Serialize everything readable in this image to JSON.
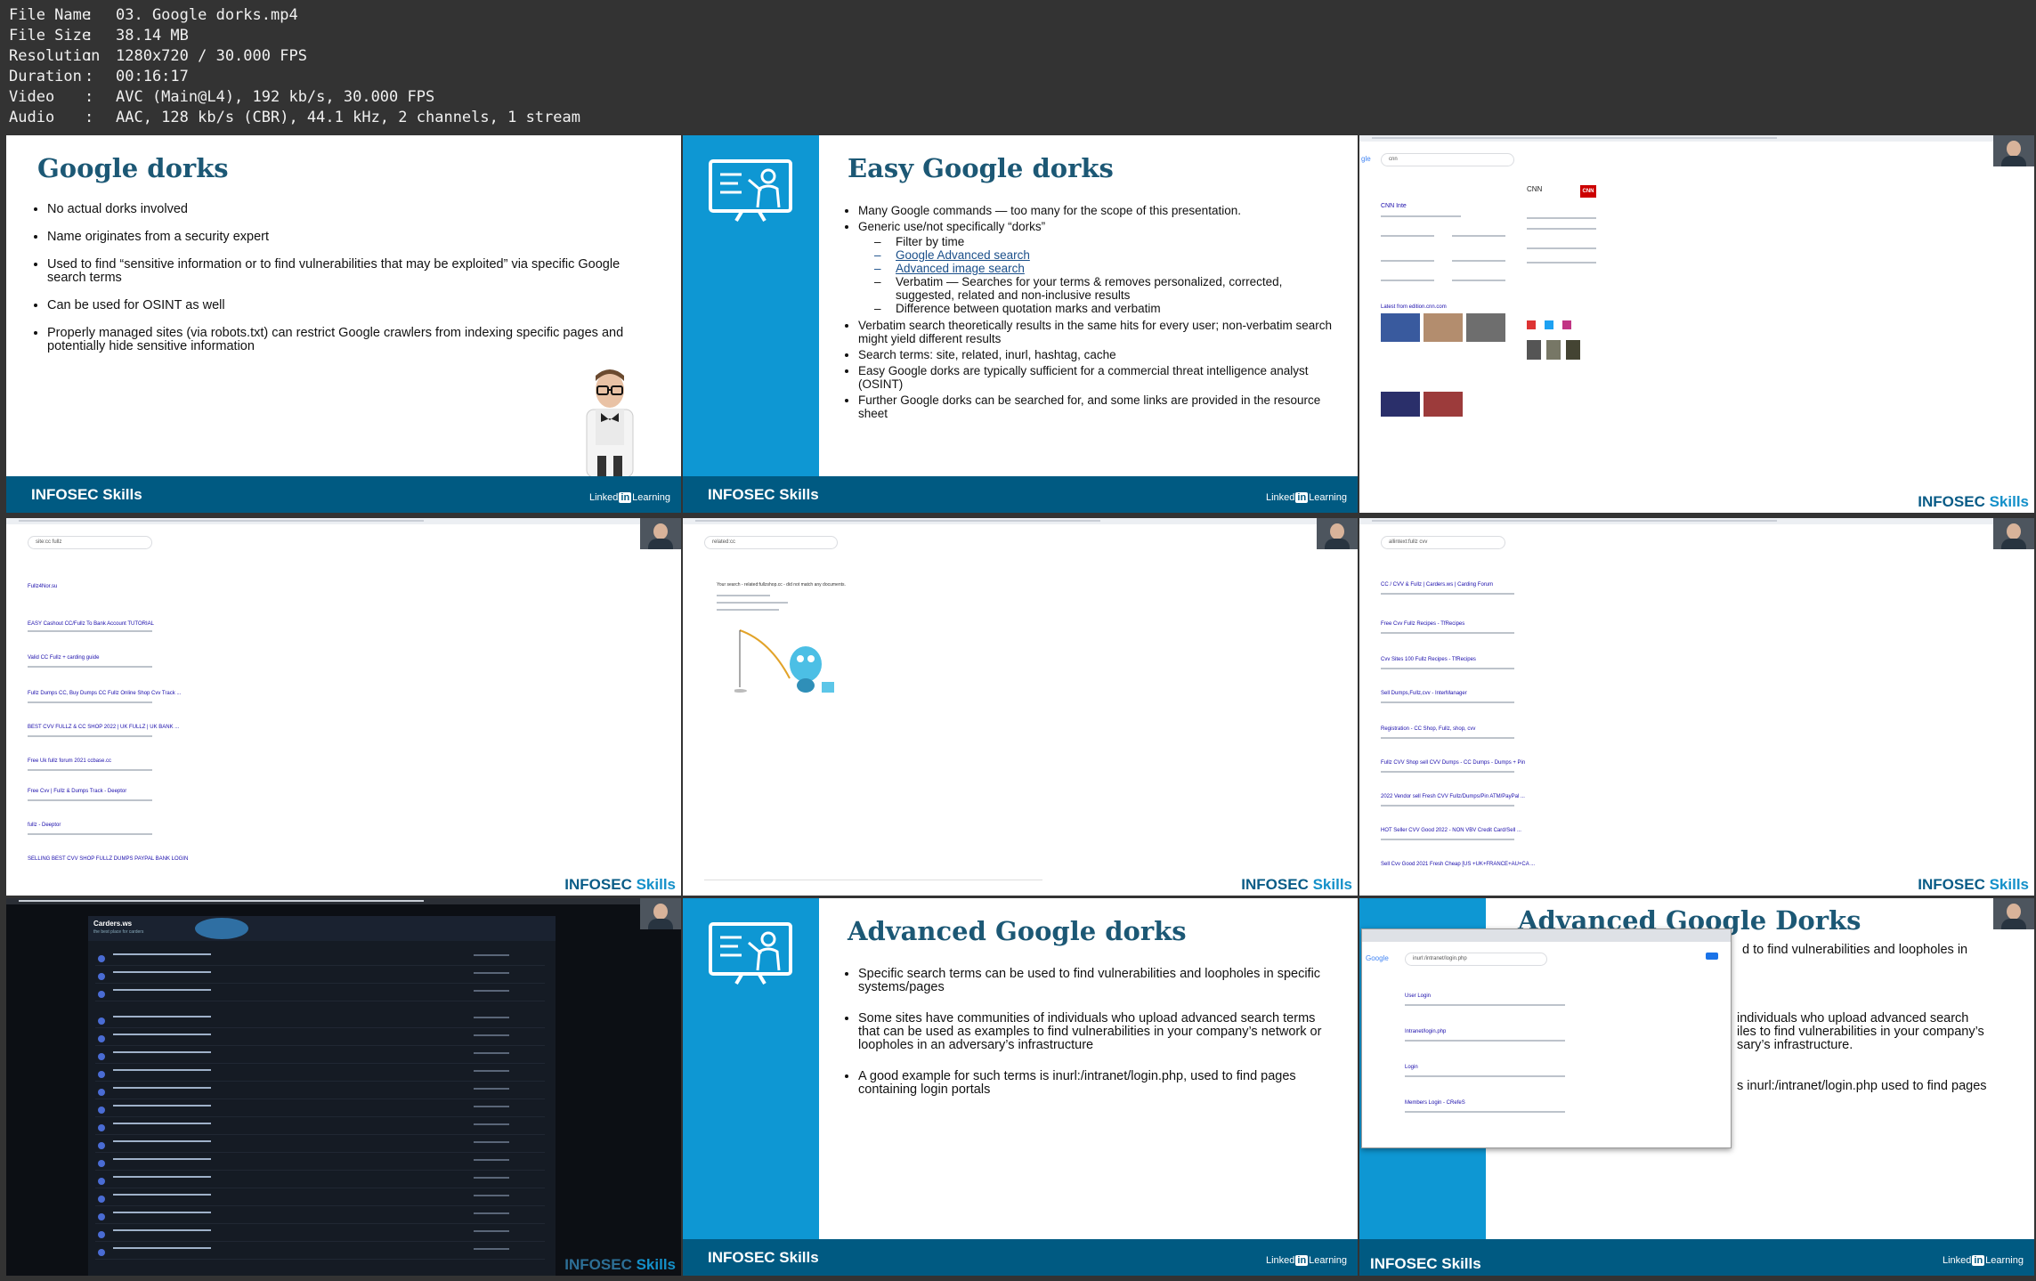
{
  "media_info": {
    "rows": [
      {
        "key": "File Name",
        "value": "03. Google dorks.mp4"
      },
      {
        "key": "File Size",
        "value": "38.14 MB"
      },
      {
        "key": "Resolution",
        "value": "1280x720 / 30.000 FPS"
      },
      {
        "key": "Duration",
        "value": "00:16:17"
      },
      {
        "key": "Video",
        "value": "AVC (Main@L4), 192 kb/s, 30.000 FPS"
      },
      {
        "key": "Audio",
        "value": "AAC, 128 kb/s (CBR), 44.1 kHz, 2 channels, 1 stream"
      }
    ]
  },
  "branding": {
    "infosec": "INFOSEC Skills",
    "linkedin_pre": "Linked",
    "linkedin_in": "in",
    "linkedin_post": "Learning",
    "watermark_a": "INFOSEC",
    "watermark_b": "Skills"
  },
  "slide1": {
    "title": "Google dorks",
    "bullets": [
      "No actual dorks involved",
      "Name originates from a security expert",
      "Used to find “sensitive information or to find vulnerabilities that may be exploited” via specific Google search terms",
      "Can be used for OSINT as well",
      "Properly managed sites (via robots.txt) can restrict Google crawlers from indexing specific pages and potentially hide sensitive information"
    ]
  },
  "slide2": {
    "title": "Easy Google dorks",
    "b1": "Many Google commands — too many for the scope of this presentation.",
    "b2": "Generic use/not specifically “dorks”",
    "sub": [
      "Filter by time",
      "Google Advanced search",
      "Advanced image search",
      "Verbatim — Searches for your terms & removes personalized, corrected, suggested, related and non-inclusive results",
      "Difference between quotation marks and verbatim"
    ],
    "b3": "Verbatim search theoretically results in the same hits for every user; non-verbatim search might yield different results",
    "b4": "Search terms: site, related, inurl, hashtag, cache",
    "b5": "Easy Google dorks are typically sufficient for a commercial threat intelligence analyst (OSINT)",
    "b6": "Further Google dorks can be searched for, and some links are provided in the resource sheet"
  },
  "screen3": {
    "search": "cnn",
    "panel_title": "CNN",
    "logo": "CNN",
    "result1": "CNN Inte",
    "result2": "Latest from edition.cnn.com"
  },
  "screen4": {
    "search": "site:cc fullz",
    "result1": "Fullz4Nor.su",
    "result2": "EASY Cashout CC/Fullz To Bank Account TUTORIAL",
    "result3": "Valid CC Fullz + carding guide",
    "result4": "Fullz Dumps CC, Buy Dumps CC Fullz Online Shop Cvv Track ...",
    "result5": "BEST CVV FULLZ & CC SHOP 2022 | UK FULLZ | UK BANK ...",
    "result6": "Free Uk fullz forum 2021 ccbase.cc",
    "result7": "Free Cvv | Fullz & Dumps Track - Deeptor",
    "result8": "fullz - Deeptor",
    "result9": "SELLING BEST CVV SHOP FULLZ DUMPS PAYPAL BANK LOGIN"
  },
  "screen5": {
    "search": "related:cc",
    "message": "Your search - related:fullzshop.cc - did not match any documents."
  },
  "screen6": {
    "search": "allintext:fullz cvv",
    "result1": "CC / CVV & Fullz | Carders.ws | Carding Forum",
    "result2": "Free Cvv Fullz Recipes - TfRecipes",
    "result3": "Cvv Sites 100 Fullz Recipes - TfRecipes",
    "result4": "Sell Dumps,Fullz,cvv - InterManager",
    "result5": "Registration - CC Shop, Fullz, shop, cvv",
    "result6": "Fullz CVV Shop sell CVV Dumps - CC Dumps - Dumps + Pin",
    "result7": "2022 Vendor sell Fresh CVV Fullz/Dumps/Pin ATM/PayPal ...",
    "result8": "HOT Seller CVV Good 2022 - NON VBV Credit Card/Sell ...",
    "result9": "Sell Cvv Good 2021 Fresh Cheap [US +UK+FRANCE+AU+CA ..."
  },
  "screen7": {
    "site_title": "Carders.ws",
    "tagline": "the best place for carders"
  },
  "slide8": {
    "title": "Advanced Google dorks",
    "bullets": [
      "Specific search terms can be used to find vulnerabilities and loopholes in specific systems/pages",
      "Some sites have communities of individuals who upload advanced search terms that can be used as examples to find vulnerabilities in your company’s network or loopholes in an adversary’s infrastructure",
      "A good example for such terms is inurl:/intranet/login.php, used to find pages containing login portals"
    ]
  },
  "slide9": {
    "title": "Advanced Google Dorks",
    "frag1": "d to find vulnerabilities and loopholes in",
    "frag2": "individuals who upload advanced search",
    "frag3": "iles to find vulnerabilities in your company’s",
    "frag4": "sary’s infrastructure.",
    "frag5": "s inurl:/intranet/login.php used to find pages",
    "search": "inurl:/intranet/login.php",
    "result1": "User Login",
    "result2": "Intranet/login.php",
    "result3": "Login",
    "result4": "Members Login - CRefeS"
  }
}
